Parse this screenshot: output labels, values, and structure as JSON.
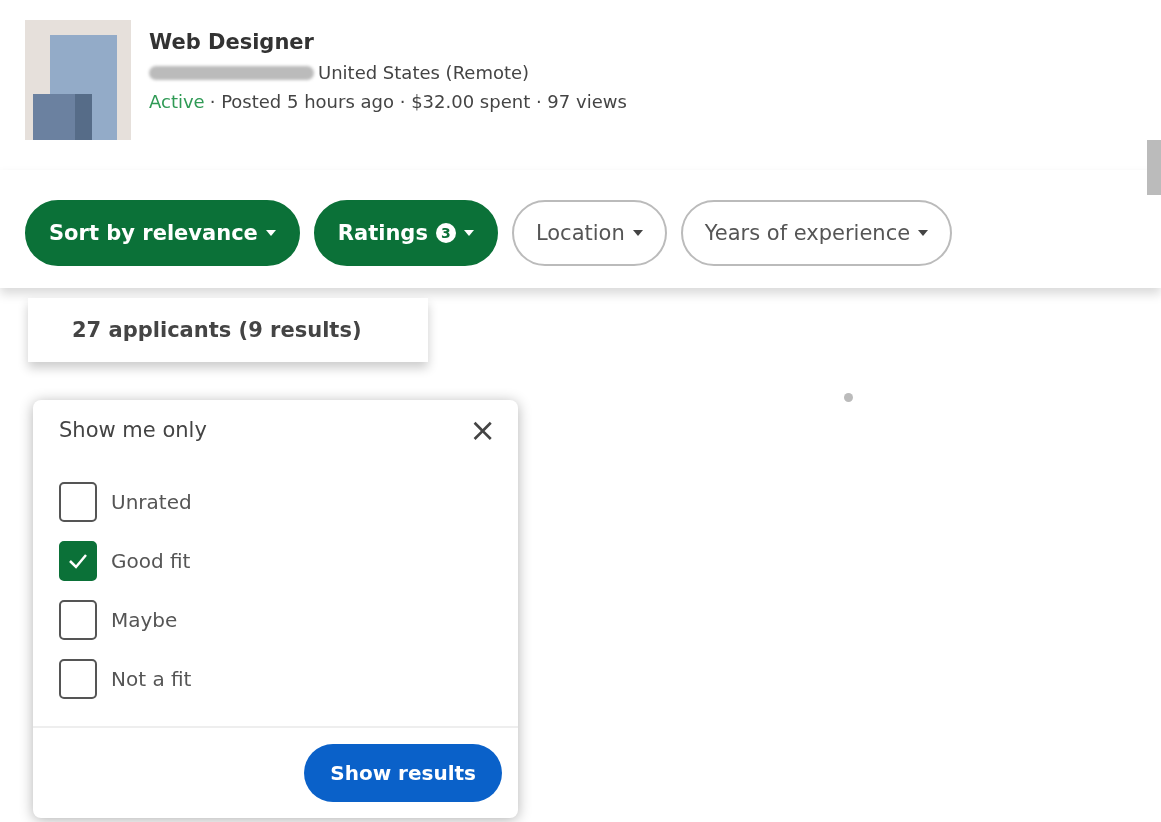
{
  "job": {
    "title": "Web Designer",
    "location": "United States (Remote)",
    "status": "Active",
    "meta": "· Posted 5 hours ago · $32.00 spent · 97 views"
  },
  "filters": [
    {
      "label": "Sort by relevance",
      "selected": true
    },
    {
      "label": "Ratings",
      "selected": true,
      "count": "3"
    },
    {
      "label": "Location",
      "selected": false
    },
    {
      "label": "Years of experience",
      "selected": false
    }
  ],
  "results": {
    "count": "27 applicants (9 results)"
  },
  "popup": {
    "title": "Show me only",
    "close": "×",
    "options": [
      {
        "label": "Unrated",
        "checked": false
      },
      {
        "label": "Good fit",
        "checked": true
      },
      {
        "label": "Maybe",
        "checked": false
      },
      {
        "label": "Not a fit",
        "checked": false
      }
    ],
    "button": "Show results"
  }
}
